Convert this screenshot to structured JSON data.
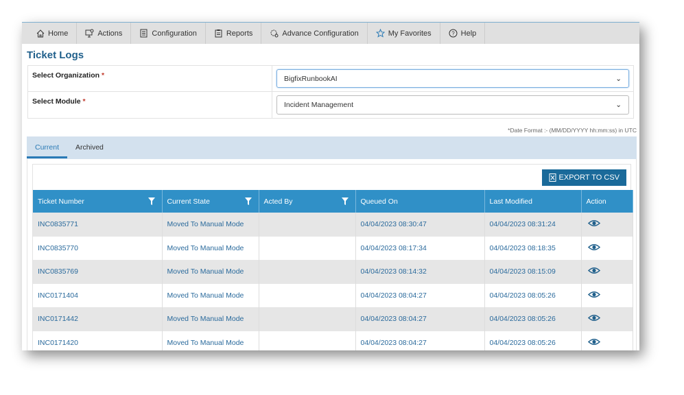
{
  "nav": [
    {
      "label": "Home",
      "icon": "home-icon"
    },
    {
      "label": "Actions",
      "icon": "monitor-icon"
    },
    {
      "label": "Configuration",
      "icon": "list-icon"
    },
    {
      "label": "Reports",
      "icon": "clipboard-icon"
    },
    {
      "label": "Advance Configuration",
      "icon": "gear-icon"
    },
    {
      "label": "My Favorites",
      "icon": "star-icon"
    },
    {
      "label": "Help",
      "icon": "help-icon"
    }
  ],
  "title": "Ticket Logs",
  "form": {
    "org_label": "Select Organization",
    "org_value": "BigfixRunbookAI",
    "module_label": "Select Module",
    "module_value": "Incident Management",
    "required": "*"
  },
  "date_format": "*Date Format :- (MM/DD/YYYY hh:mm:ss) in UTC",
  "tabs": [
    "Current",
    "Archived"
  ],
  "export_label": "EXPORT TO CSV",
  "columns": [
    "Ticket Number",
    "Current State",
    "Acted By",
    "Queued On",
    "Last Modified",
    "Action"
  ],
  "rows": [
    [
      "INC0835771",
      "Moved To Manual Mode",
      "",
      "04/04/2023 08:30:47",
      "04/04/2023 08:31:24"
    ],
    [
      "INC0835770",
      "Moved To Manual Mode",
      "",
      "04/04/2023 08:17:34",
      "04/04/2023 08:18:35"
    ],
    [
      "INC0835769",
      "Moved To Manual Mode",
      "",
      "04/04/2023 08:14:32",
      "04/04/2023 08:15:09"
    ],
    [
      "INC0171404",
      "Moved To Manual Mode",
      "",
      "04/04/2023 08:04:27",
      "04/04/2023 08:05:26"
    ],
    [
      "INC0171442",
      "Moved To Manual Mode",
      "",
      "04/04/2023 08:04:27",
      "04/04/2023 08:05:26"
    ],
    [
      "INC0171420",
      "Moved To Manual Mode",
      "",
      "04/04/2023 08:04:27",
      "04/04/2023 08:05:26"
    ]
  ]
}
